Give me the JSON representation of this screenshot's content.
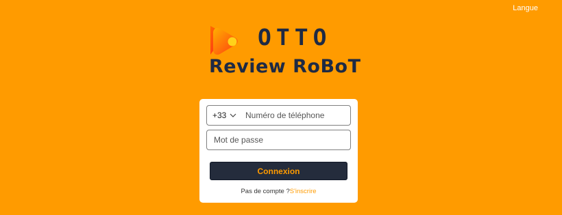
{
  "header": {
    "language_label": "Langue"
  },
  "logo": {
    "title": "OTTO",
    "subtitle": "Review RoBoT",
    "icon": "play-logo-icon"
  },
  "login_form": {
    "country_code": "+33",
    "phone_placeholder": "Numéro de téléphone",
    "password_placeholder": "Mot de passe",
    "submit_label": "Connexion",
    "no_account_text": "Pas de compte ?",
    "signup_link": "S'inscrire"
  },
  "colors": {
    "background": "#ff9b00",
    "accent": "#ff9b00",
    "button": "#242c3c",
    "logo_text": "#1e2a44"
  }
}
